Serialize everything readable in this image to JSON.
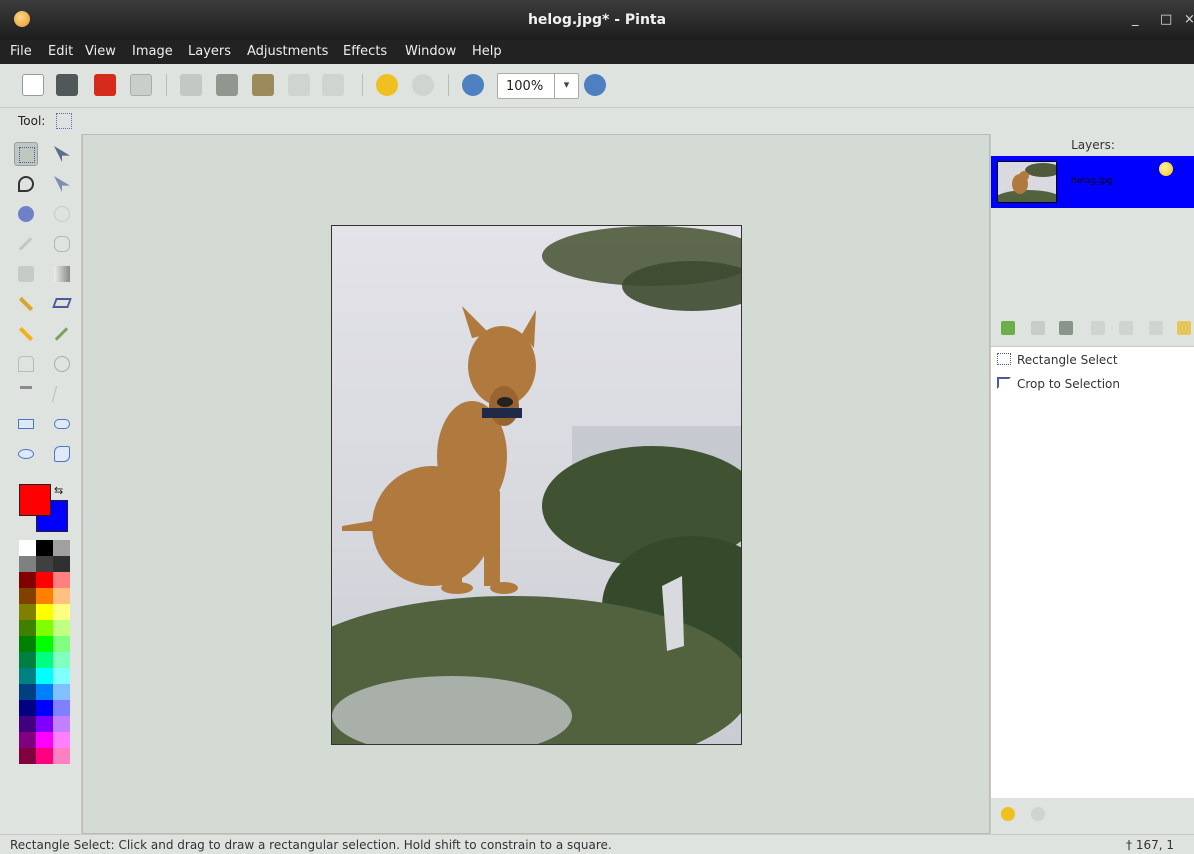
{
  "window": {
    "title": "helog.jpg* - Pinta",
    "minimize": "_",
    "maximize": "□",
    "close": "×"
  },
  "menu": [
    "File",
    "Edit",
    "View",
    "Image",
    "Layers",
    "Adjustments",
    "Effects",
    "Window",
    "Help"
  ],
  "toolbar": {
    "zoom_value": "100%",
    "zoom_dropdown": "▾"
  },
  "tool_options": {
    "label": "Tool:"
  },
  "colors": {
    "primary": "#ff0000",
    "secondary": "#0000ff",
    "selection": "#0000ff"
  },
  "palette": [
    "#ffffff",
    "#000000",
    "#a0a0a0",
    "#808080",
    "#404040",
    "#303030",
    "#800000",
    "#ff0000",
    "#ff8080",
    "#804000",
    "#ff8000",
    "#ffc080",
    "#808000",
    "#ffff00",
    "#ffff80",
    "#408000",
    "#80ff00",
    "#c0ff80",
    "#008000",
    "#00ff00",
    "#80ff80",
    "#008040",
    "#00ff80",
    "#80ffc0",
    "#008080",
    "#00ffff",
    "#80ffff",
    "#004080",
    "#0080ff",
    "#80c0ff",
    "#000080",
    "#0000ff",
    "#8080ff",
    "#400080",
    "#8000ff",
    "#c080ff",
    "#800080",
    "#ff00ff",
    "#ff80ff",
    "#800040",
    "#ff0080",
    "#ff80c0"
  ],
  "layers": {
    "title": "Layers:",
    "items": [
      {
        "name": "helog.jpg"
      }
    ]
  },
  "history": {
    "items": [
      {
        "label": "Rectangle Select"
      },
      {
        "label": "Crop to Selection"
      }
    ]
  },
  "status": {
    "hint": "Rectangle Select: Click and drag to draw a rectangular selection. Hold shift to constrain to a square.",
    "cursor_position": "167, 1"
  }
}
